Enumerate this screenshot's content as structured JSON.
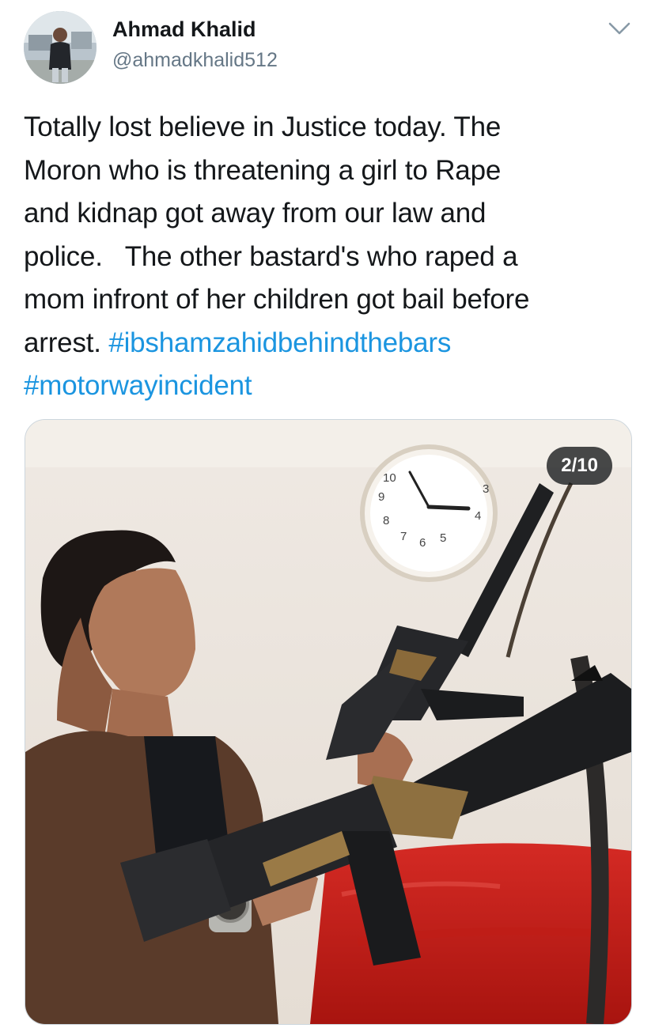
{
  "author": {
    "name": "Ahmad Khalid",
    "handle": "@ahmadkhalid512",
    "avatar_icon": "profile-photo"
  },
  "menu": {
    "icon": "chevron-down-icon"
  },
  "tweet": {
    "lines": [
      "Totally lost believe in Justice today. The",
      "Moron who is threatening a girl to Rape",
      "and kidnap got away from our law and",
      "police.   The other bastard's who raped a",
      "mom infront of her children got bail before"
    ],
    "last_line_prefix": "arrest. ",
    "hashtags": [
      "#ibshamzahidbehindthebars",
      "#motorwayincident"
    ]
  },
  "media": {
    "counter": "2/10",
    "clock_numbers": [
      "10",
      "9",
      "8",
      "7",
      "6",
      "5",
      "4",
      "3"
    ]
  },
  "colors": {
    "text": "#14171a",
    "secondary": "#657786",
    "link": "#1b95e0",
    "border": "#ccd6dd"
  }
}
